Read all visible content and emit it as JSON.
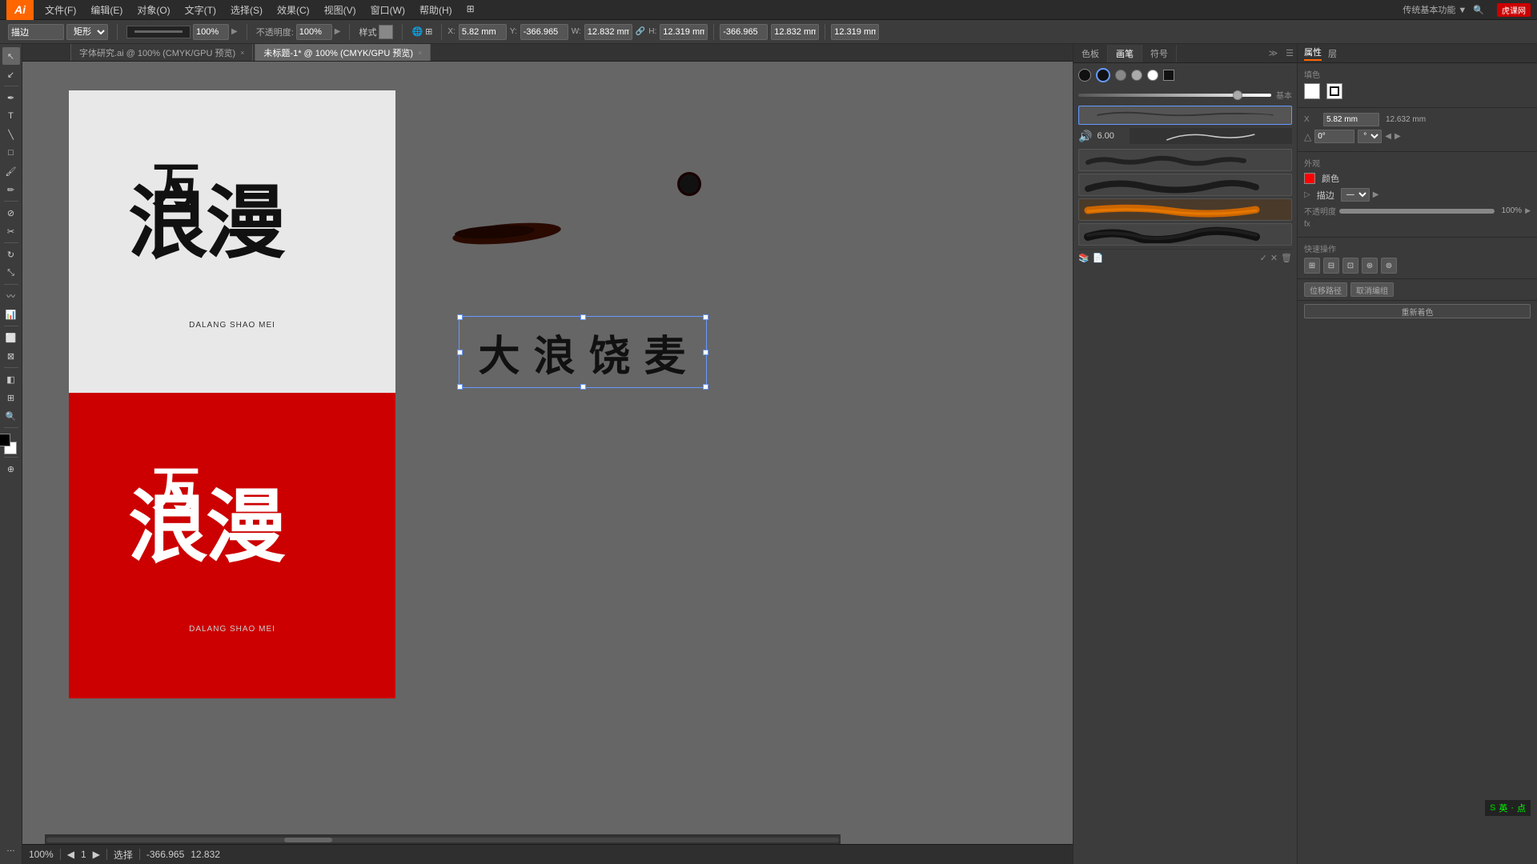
{
  "app": {
    "logo": "Ai",
    "title": "Adobe Illustrator"
  },
  "menu": {
    "items": [
      "文件(F)",
      "编辑(E)",
      "对象(O)",
      "文字(T)",
      "选择(S)",
      "效果(C)",
      "视图(V)",
      "窗口(W)",
      "帮助(H)"
    ]
  },
  "toolbar": {
    "mode": "描边",
    "stroke_width": "100%",
    "opacity": "100%",
    "style_label": "样式",
    "x_label": "X:",
    "x_val": "5.82 mm",
    "y_label": "Y:",
    "y_val": "-366.965",
    "w_label": "W:",
    "w_val": "12.832 mm",
    "h_label": "H:",
    "h_val": "12.319 mm",
    "ref_x": "-366.965",
    "ref_y": "12.832 mm"
  },
  "tabs": [
    {
      "label": "字体研究.ai @ 100% (CMYK/GPU 预览)",
      "active": false,
      "closable": true
    },
    {
      "label": "未标题-1* @ 100% (CMYK/GPU 预览)",
      "active": true,
      "closable": true
    }
  ],
  "canvas": {
    "art_text_line1": "浪",
    "art_text_line2": "漫",
    "art_kanji_big": "大 浪 饶 麦",
    "sub_text_black": "DALANG\nSHAO\nMEI",
    "sub_text_white": "DALANG\nSHAO\nMEI"
  },
  "brush_panel": {
    "tabs": [
      "色板",
      "画笔",
      "符号"
    ],
    "active_tab": "画笔",
    "color_dots": [
      "black",
      "dark",
      "light",
      "lighter",
      "white"
    ],
    "volume_value": "6.00",
    "basic_label": "基本",
    "opacity_label": "不透明度",
    "opacity_value": "100%"
  },
  "right_panel": {
    "tabs": [
      "属性",
      "层"
    ],
    "active_tab": "属性",
    "section_title": "填色",
    "x_label": "X",
    "x_val": "5.82 mm",
    "y_val": "12.632 mm",
    "angle_val": "0°",
    "opacity_label": "不透明度",
    "opacity_val": "100%",
    "outer_title": "外观",
    "color_label": "颜色",
    "stroke_label": "描边",
    "opacity2_label": "不透明度",
    "opacity2_val": "100%",
    "quick_ops": "快速操作",
    "align_path": "位移路径",
    "expand": "取消编组",
    "new_color": "重新着色"
  },
  "status_bar": {
    "zoom": "100%",
    "artboard_label": "选择",
    "page_num": "1",
    "nav_prev": "◀",
    "nav_next": "▶"
  },
  "tiger_logo": "虎课网",
  "coord_bottom": {
    "x": "-366.965",
    "y": "12.832"
  }
}
